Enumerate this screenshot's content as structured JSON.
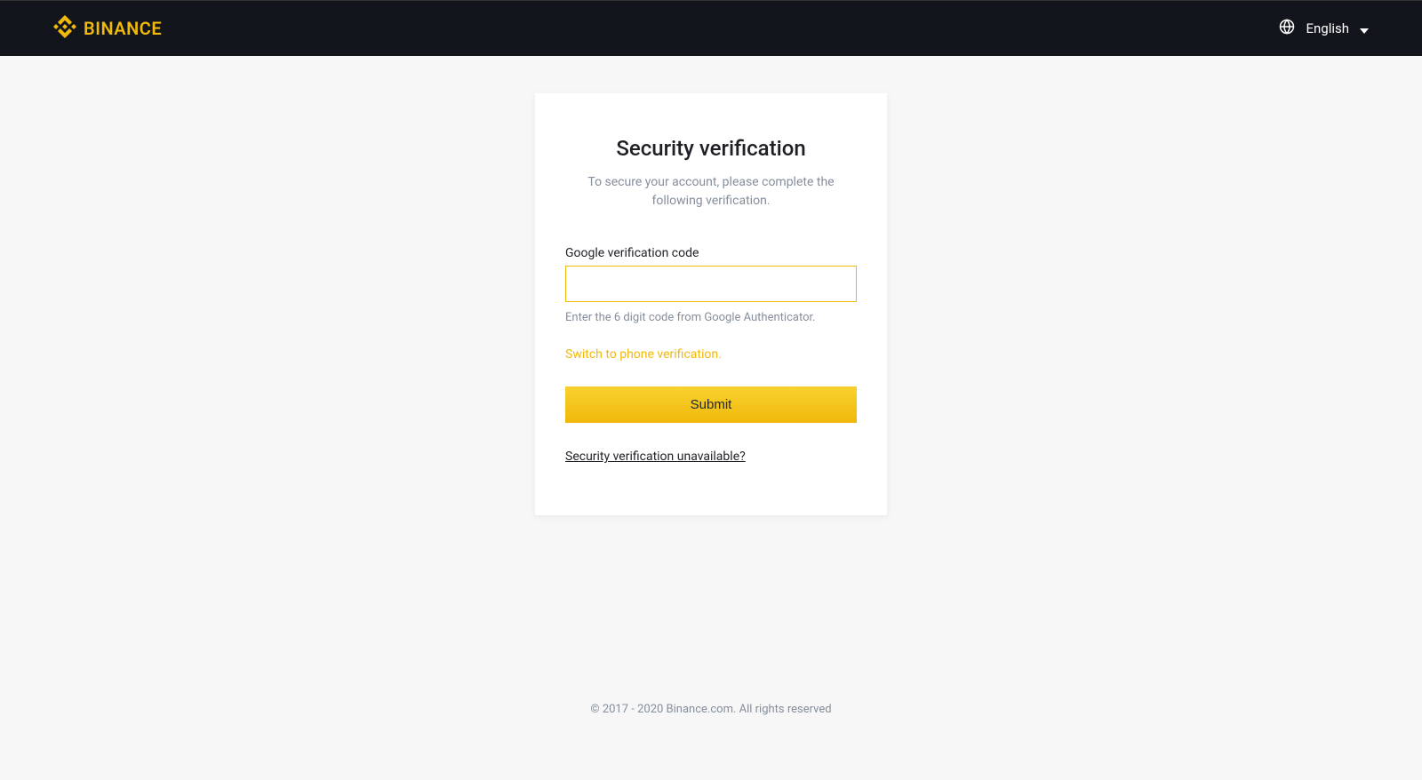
{
  "header": {
    "brand": "BINANCE",
    "language": "English"
  },
  "card": {
    "title": "Security verification",
    "subtitle": "To secure your account, please complete the following verification.",
    "field_label": "Google verification code",
    "input_value": "",
    "helper_text": "Enter the 6 digit code from Google Authenticator.",
    "switch_link": "Switch to phone verification.",
    "submit_label": "Submit",
    "unavailable_link": "Security verification unavailable?"
  },
  "footer": {
    "copyright": "© 2017 - 2020 Binance.com. All rights reserved"
  },
  "colors": {
    "accent": "#F0B90B",
    "header_bg": "#12161C",
    "text_muted": "#848e9c"
  }
}
